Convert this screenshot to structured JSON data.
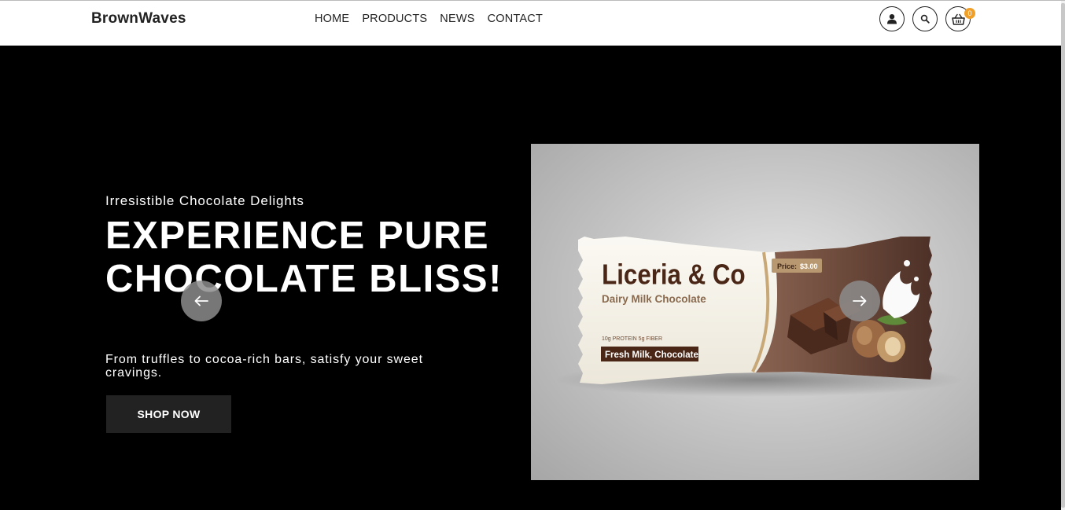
{
  "header": {
    "logo": "BrownWaves",
    "nav": [
      "HOME",
      "PRODUCTS",
      "NEWS",
      "CONTACT"
    ],
    "cart_count": "0"
  },
  "hero": {
    "subtitle": "Irresistible Chocolate Delights",
    "headline": "EXPERIENCE PURE CHOCOLATE BLISS!",
    "description": "From truffles to cocoa-rich bars, satisfy your sweet cravings.",
    "cta": "SHOP NOW"
  },
  "product": {
    "brand": "Liceria & Co",
    "name": "Dairy Milk Chocolate",
    "price_label": "Price:",
    "price": "$3.00",
    "nutrition": "10g PROTEIN 5g FIBER",
    "ingredients": "Fresh Milk, Chocolate"
  },
  "icons": {
    "user": "user-icon",
    "search": "search-icon",
    "cart": "basket-icon",
    "prev": "arrow-left-icon",
    "next": "arrow-right-icon"
  },
  "colors": {
    "hero_bg": "#000000",
    "header_bg": "#ffffff",
    "button_bg": "#222222",
    "badge": "#f0a028",
    "wrapper_brown": "#5a3a2c",
    "brand_text": "#4a2616"
  }
}
